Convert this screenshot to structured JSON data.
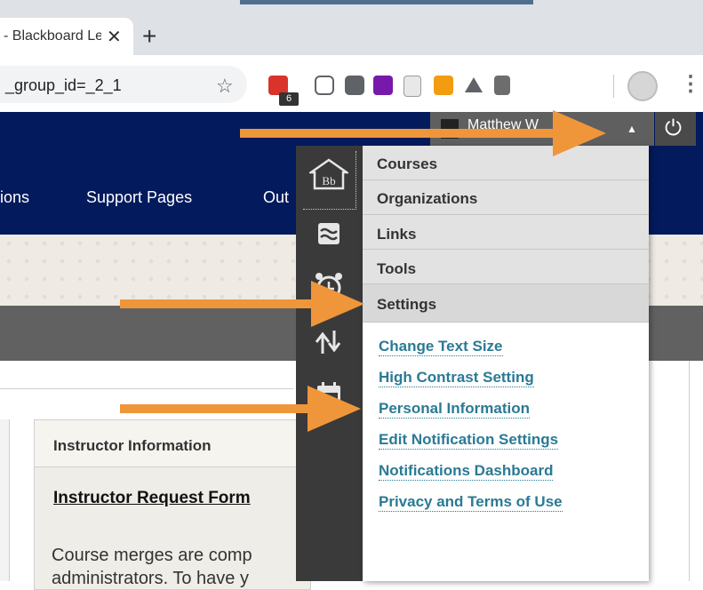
{
  "browser": {
    "tab_title": "- Blackboard Learn",
    "tab_close": "✕",
    "new_tab": "+",
    "url_text": "_group_id=_2_1",
    "star": "☆",
    "ext_badge_count": "6",
    "kebab": "⋮"
  },
  "header": {
    "user_name": "Matthew W",
    "caret": "▲",
    "power": "⏻",
    "nav": [
      "ions",
      "Support Pages",
      "Out"
    ]
  },
  "content": {
    "instructor_title": "Instructor Information",
    "instructor_link": "Instructor Request Form",
    "body_line1": "Course merges are comp",
    "body_line2": "administrators. To have y"
  },
  "menu": {
    "categories": [
      "Courses",
      "Organizations",
      "Links",
      "Tools",
      "Settings"
    ],
    "settings_links": [
      "Change Text Size",
      "High Contrast Setting",
      "Personal Information",
      "Edit Notification Settings",
      "Notifications Dashboard",
      "Privacy and Terms of Use"
    ]
  },
  "colors": {
    "header_navy": "#031a5c",
    "arrow_orange": "#f0963a",
    "link_teal": "#2a7a94"
  }
}
